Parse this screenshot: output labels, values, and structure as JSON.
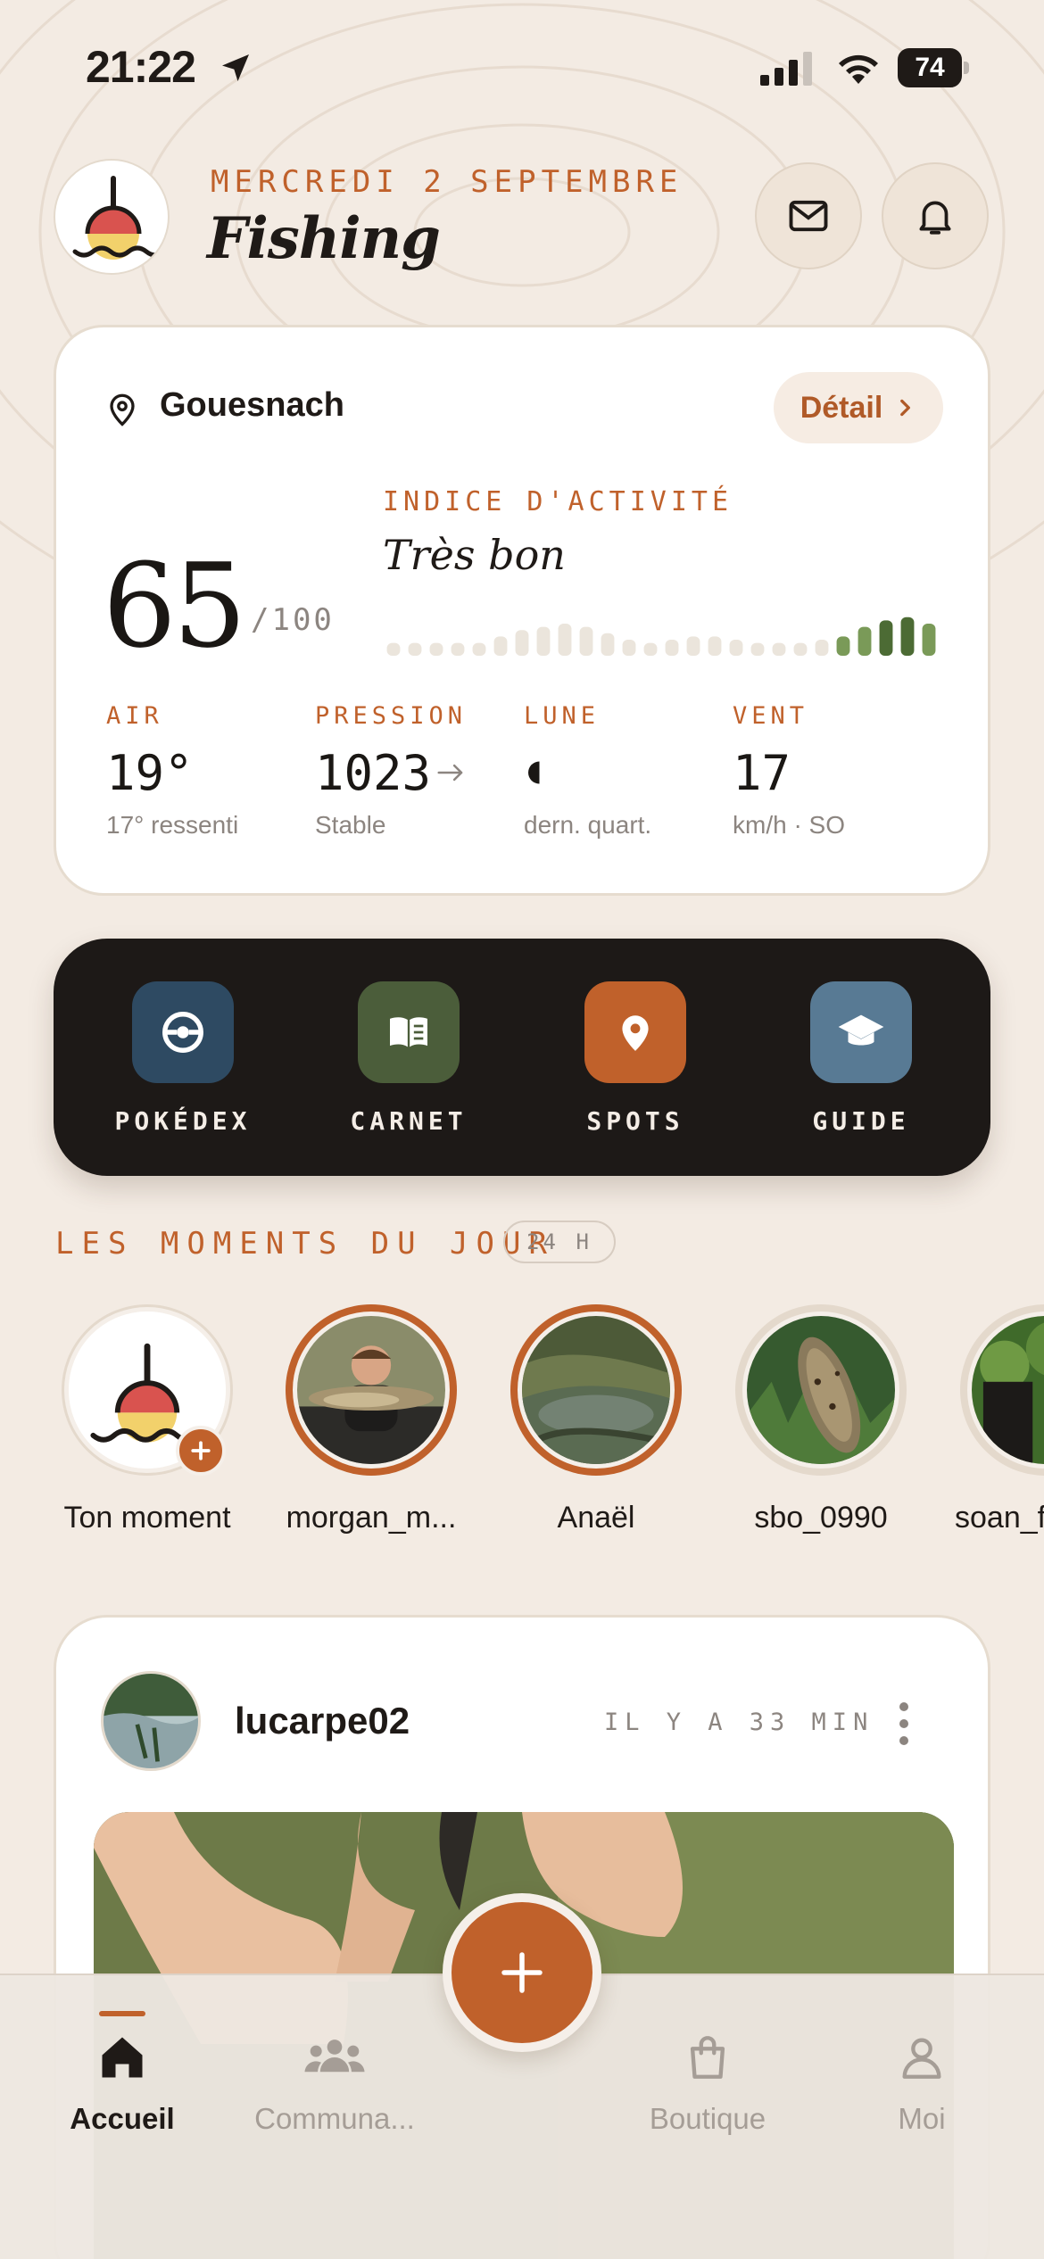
{
  "status_bar": {
    "time": "21:22",
    "battery": "74",
    "battery_level": 0.74
  },
  "header": {
    "date": "MERCREDI 2 SEPTEMBRE",
    "title": "Fishing"
  },
  "weather": {
    "location": "Gouesnach",
    "detail_label": "Détail",
    "score": "65",
    "score_max": "/100",
    "activity_label": "INDICE D'ACTIVITÉ",
    "activity_value": "Très bon",
    "activity_levels": [
      0.2,
      0.2,
      0.2,
      0.2,
      0.2,
      0.3,
      0.4,
      0.45,
      0.5,
      0.45,
      0.35,
      0.25,
      0.2,
      0.25,
      0.3,
      0.3,
      0.25,
      0.2,
      0.2,
      0.2,
      0.25,
      0.3,
      0.45,
      0.55,
      0.6,
      0.5
    ],
    "activity_highlight_from": 21,
    "stats": [
      {
        "label": "AIR",
        "value": "19°",
        "sub": "17° ressenti"
      },
      {
        "label": "PRESSION",
        "value": "1023",
        "sub": "Stable"
      },
      {
        "label": "LUNE",
        "value": "",
        "sub": "dern. quart."
      },
      {
        "label": "VENT",
        "value": "17",
        "sub": "km/h · SO"
      }
    ]
  },
  "quick_access": [
    {
      "label": "POKÉDEX",
      "icon": "pokeball-icon",
      "color": "#2e4a62"
    },
    {
      "label": "CARNET",
      "icon": "book-icon",
      "color": "#4b5d3a"
    },
    {
      "label": "SPOTS",
      "icon": "location-pin-icon",
      "color": "#c0612b"
    },
    {
      "label": "GUIDE",
      "icon": "graduation-cap-icon",
      "color": "#587a94"
    }
  ],
  "moments": {
    "title": "LES MOMENTS DU JOUR",
    "badge": "24 H",
    "stories": [
      {
        "name": "Ton moment",
        "state": "own"
      },
      {
        "name": "morgan_m...",
        "state": "active"
      },
      {
        "name": "Anaël",
        "state": "active"
      },
      {
        "name": "sbo_0990",
        "state": "seen"
      },
      {
        "name": "soan_f",
        "state": "seen"
      }
    ]
  },
  "post": {
    "user": "lucarpe02",
    "time": "IL Y A 33 MIN"
  },
  "tabs": [
    {
      "label": "Accueil",
      "icon": "home-icon",
      "active": true
    },
    {
      "label": "Communa...",
      "icon": "community-icon",
      "active": false
    },
    {
      "label": "Boutique",
      "icon": "shopping-bag-icon",
      "active": false
    },
    {
      "label": "Moi",
      "icon": "user-icon",
      "active": false
    }
  ],
  "colors": {
    "accent": "#c0612b",
    "background": "#f3ebe3",
    "dark": "#1d1917",
    "activity_green": "#7a9a58"
  }
}
